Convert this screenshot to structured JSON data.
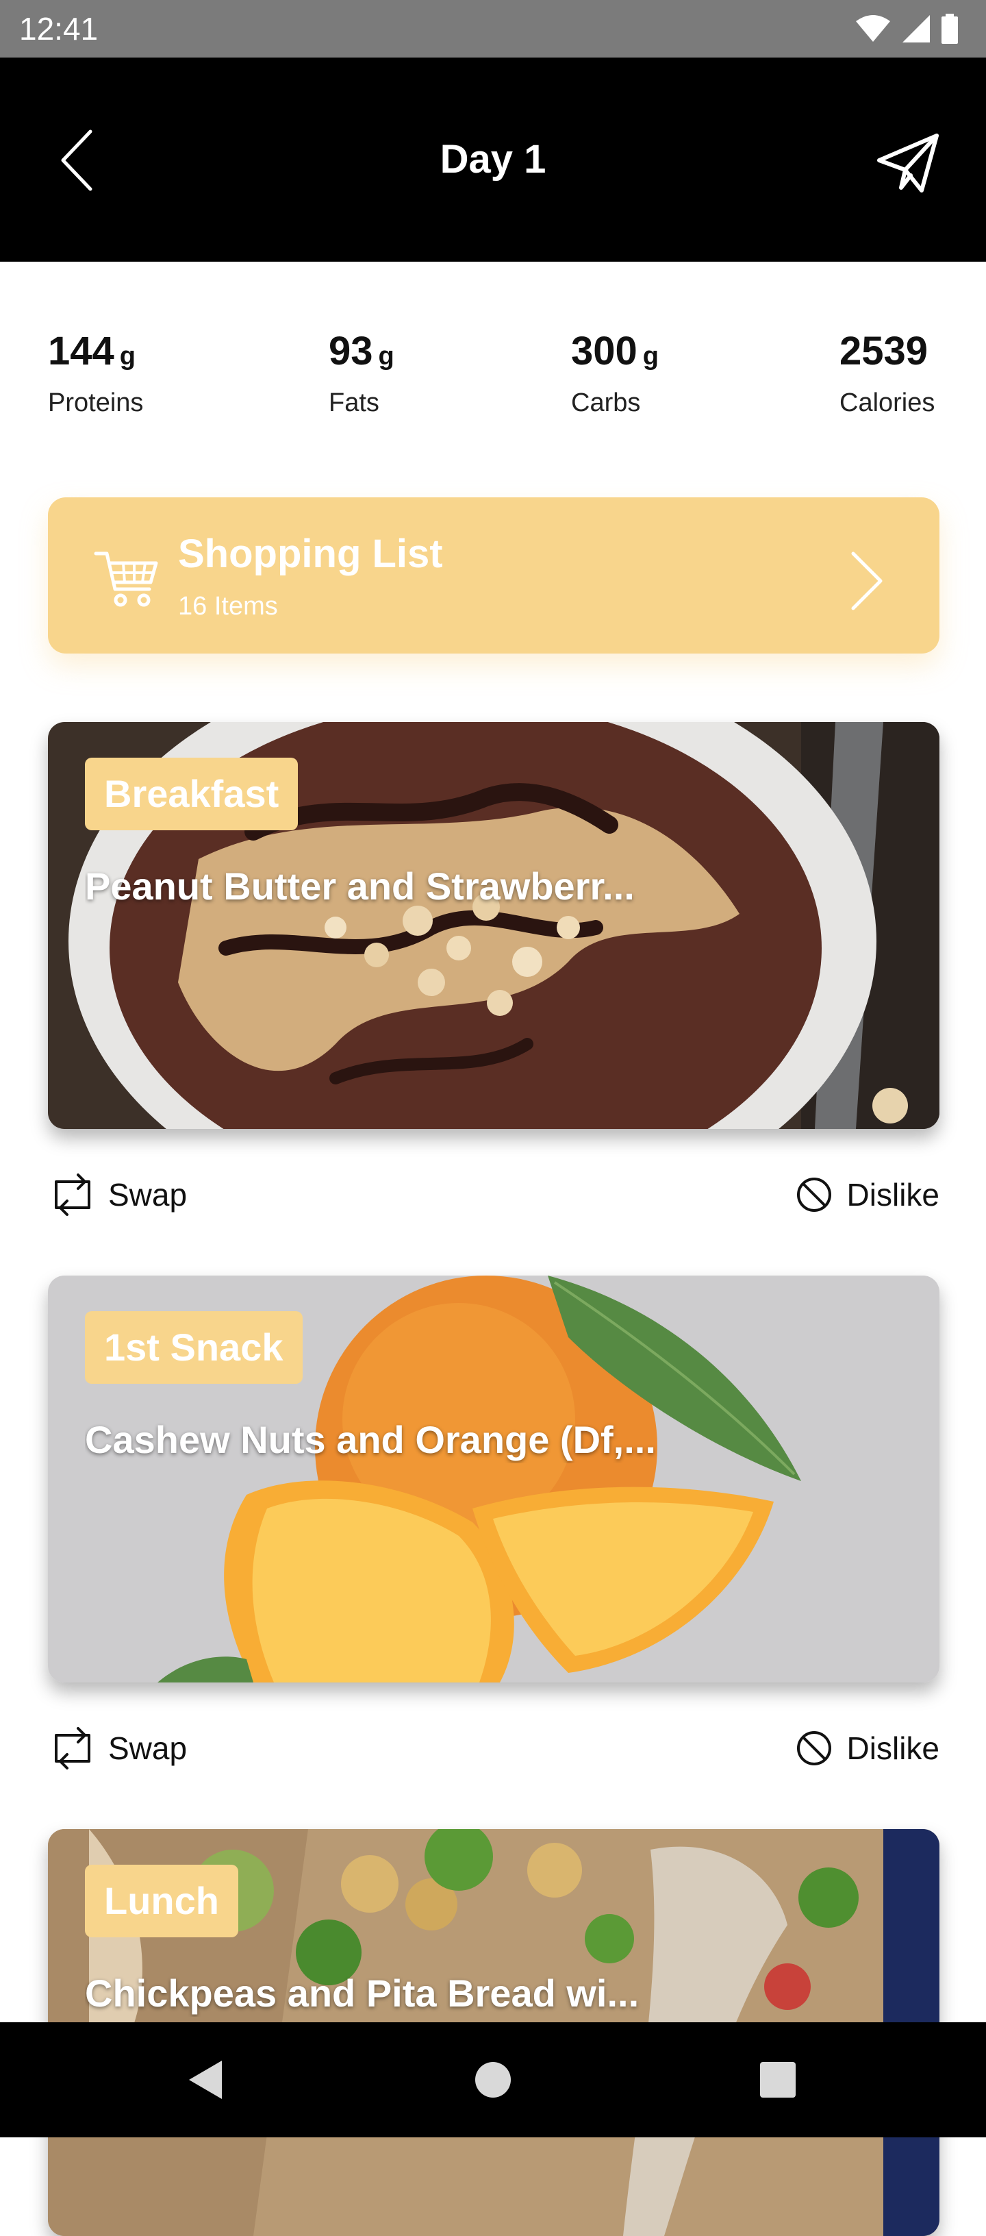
{
  "status_bar": {
    "time": "12:41"
  },
  "header": {
    "title": "Day 1",
    "back_icon": "chevron-left-icon",
    "share_icon": "paper-plane-icon"
  },
  "macros": [
    {
      "value": "144",
      "unit": "g",
      "label": "Proteins"
    },
    {
      "value": "93",
      "unit": "g",
      "label": "Fats"
    },
    {
      "value": "300",
      "unit": "g",
      "label": "Carbs"
    },
    {
      "value": "2539",
      "unit": "",
      "label": "Calories"
    }
  ],
  "shopping_list": {
    "title": "Shopping List",
    "count": "16 Items",
    "icon": "shopping-cart-icon"
  },
  "meals": [
    {
      "tag": "Breakfast",
      "name": "Peanut Butter and Strawberr..."
    },
    {
      "tag": "1st Snack",
      "name": "Cashew Nuts and Orange (Df,..."
    },
    {
      "tag": "Lunch",
      "name": "Chickpeas and Pita Bread wi..."
    }
  ],
  "actions": {
    "swap_label": "Swap",
    "dislike_label": "Dislike"
  },
  "colors": {
    "accent": "#f8d58c",
    "header_background": "#000000",
    "status_bar_background": "#7b7b7b"
  }
}
